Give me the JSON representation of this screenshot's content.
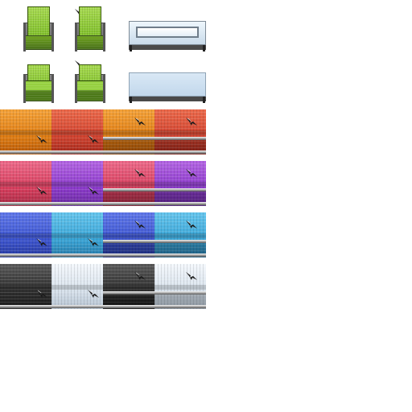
{
  "sprite_sheet": {
    "chairs": [
      {
        "color": "green",
        "view": "back",
        "tear": false
      },
      {
        "color": "green",
        "view": "back",
        "tear": true
      },
      {
        "color": "green",
        "view": "front",
        "tear": false
      },
      {
        "color": "green",
        "view": "front",
        "tear": true
      }
    ],
    "tables": [
      {
        "style": "glass-framed"
      },
      {
        "style": "glass-solid"
      }
    ],
    "sofa_rows": [
      [
        {
          "name": "orange",
          "c1": "#f5a33a",
          "c2": "#e07e14",
          "c3": "#b85a0a"
        },
        {
          "name": "red",
          "c1": "#ec6a4c",
          "c2": "#d24430",
          "c3": "#a42b1e"
        }
      ],
      [
        {
          "name": "pink",
          "c1": "#ee6a8a",
          "c2": "#d8405f",
          "c3": "#a82a44"
        },
        {
          "name": "purple",
          "c1": "#b465e4",
          "c2": "#8d3ccc",
          "c3": "#6a2aa0"
        }
      ],
      [
        {
          "name": "blue",
          "c1": "#6078ea",
          "c2": "#3d55d0",
          "c3": "#2a3ca0"
        },
        {
          "name": "cyan",
          "c1": "#66c6ee",
          "c2": "#3aa6d8",
          "c3": "#2a7aa8"
        }
      ],
      [
        {
          "name": "black",
          "c1": "#5a5a5a",
          "c2": "#303030",
          "c3": "#1a1a1a"
        },
        {
          "name": "white",
          "c1": "#f4f8fc",
          "c2": "#d8e2ec",
          "c3": "#b4c2d0"
        }
      ]
    ],
    "accent_colors": {
      "chair_green": "#8cc63f",
      "table_glass": "#d6e6f4",
      "chrome_bar": "#b0b0b0",
      "tear_mark": "#1a1a1a"
    }
  }
}
